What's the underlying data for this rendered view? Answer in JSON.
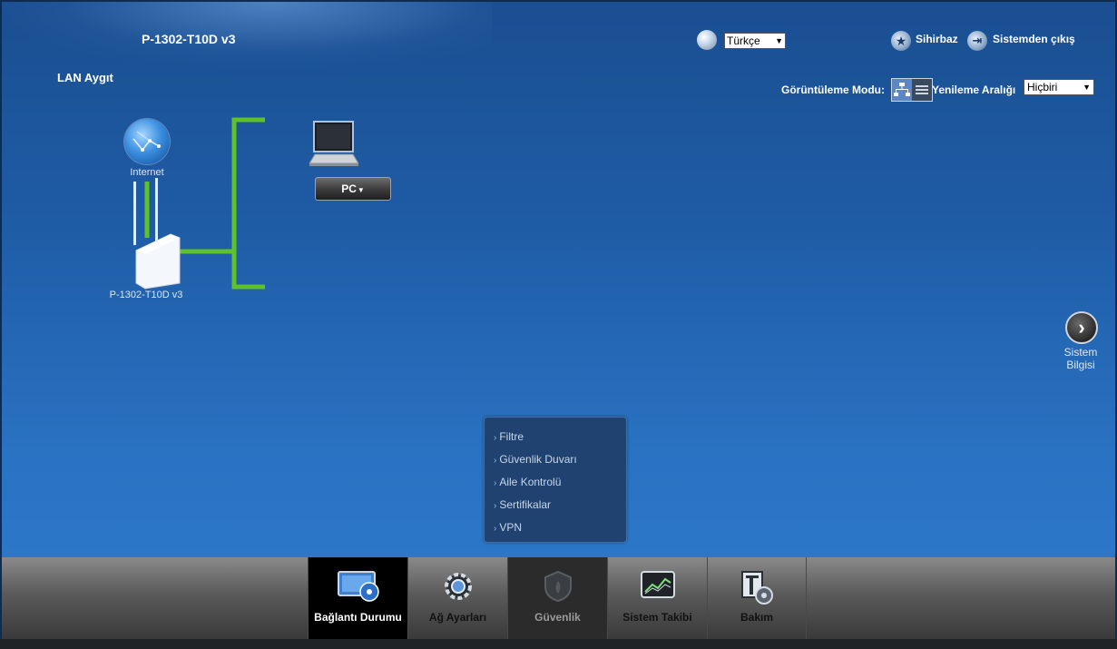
{
  "header": {
    "model": "P-1302-T10D v3",
    "section_title": "LAN Aygıt",
    "language": {
      "selected": "Türkçe",
      "icon": "globe-language-icon"
    },
    "wizard_label": "Sihirbaz",
    "logout_label": "Sistemden çıkış"
  },
  "toolbar": {
    "view_mode_label": "Görüntüleme Modu:",
    "refresh_label": "Yenileme Aralığı",
    "refresh_selected": "Hiçbiri"
  },
  "topology": {
    "internet_label": "Internet",
    "router_label": "P-1302-T10D v3",
    "pc_button_label": "PC",
    "link_color": "#5fc228"
  },
  "side": {
    "system_info_line1": "Sistem",
    "system_info_line2": "Bilgisi"
  },
  "security_menu": {
    "items": [
      "Filtre",
      "Güvenlik Duvarı",
      "Aile Kontrolü",
      "Sertifikalar",
      "VPN"
    ]
  },
  "bottom_nav": {
    "tabs": [
      {
        "label": "Bağlantı Durumu",
        "icon": "monitor-icon",
        "state": "active"
      },
      {
        "label": "Ağ Ayarları",
        "icon": "gear-icon",
        "state": "normal"
      },
      {
        "label": "Güvenlik",
        "icon": "shield-icon",
        "state": "dim"
      },
      {
        "label": "Sistem Takibi",
        "icon": "chart-monitor-icon",
        "state": "normal"
      },
      {
        "label": "Bakım",
        "icon": "maintenance-icon",
        "state": "normal"
      }
    ]
  },
  "colors": {
    "background_top": "#1a4f91",
    "background_bottom": "#2f7bcf",
    "active_tab": "#000000"
  }
}
